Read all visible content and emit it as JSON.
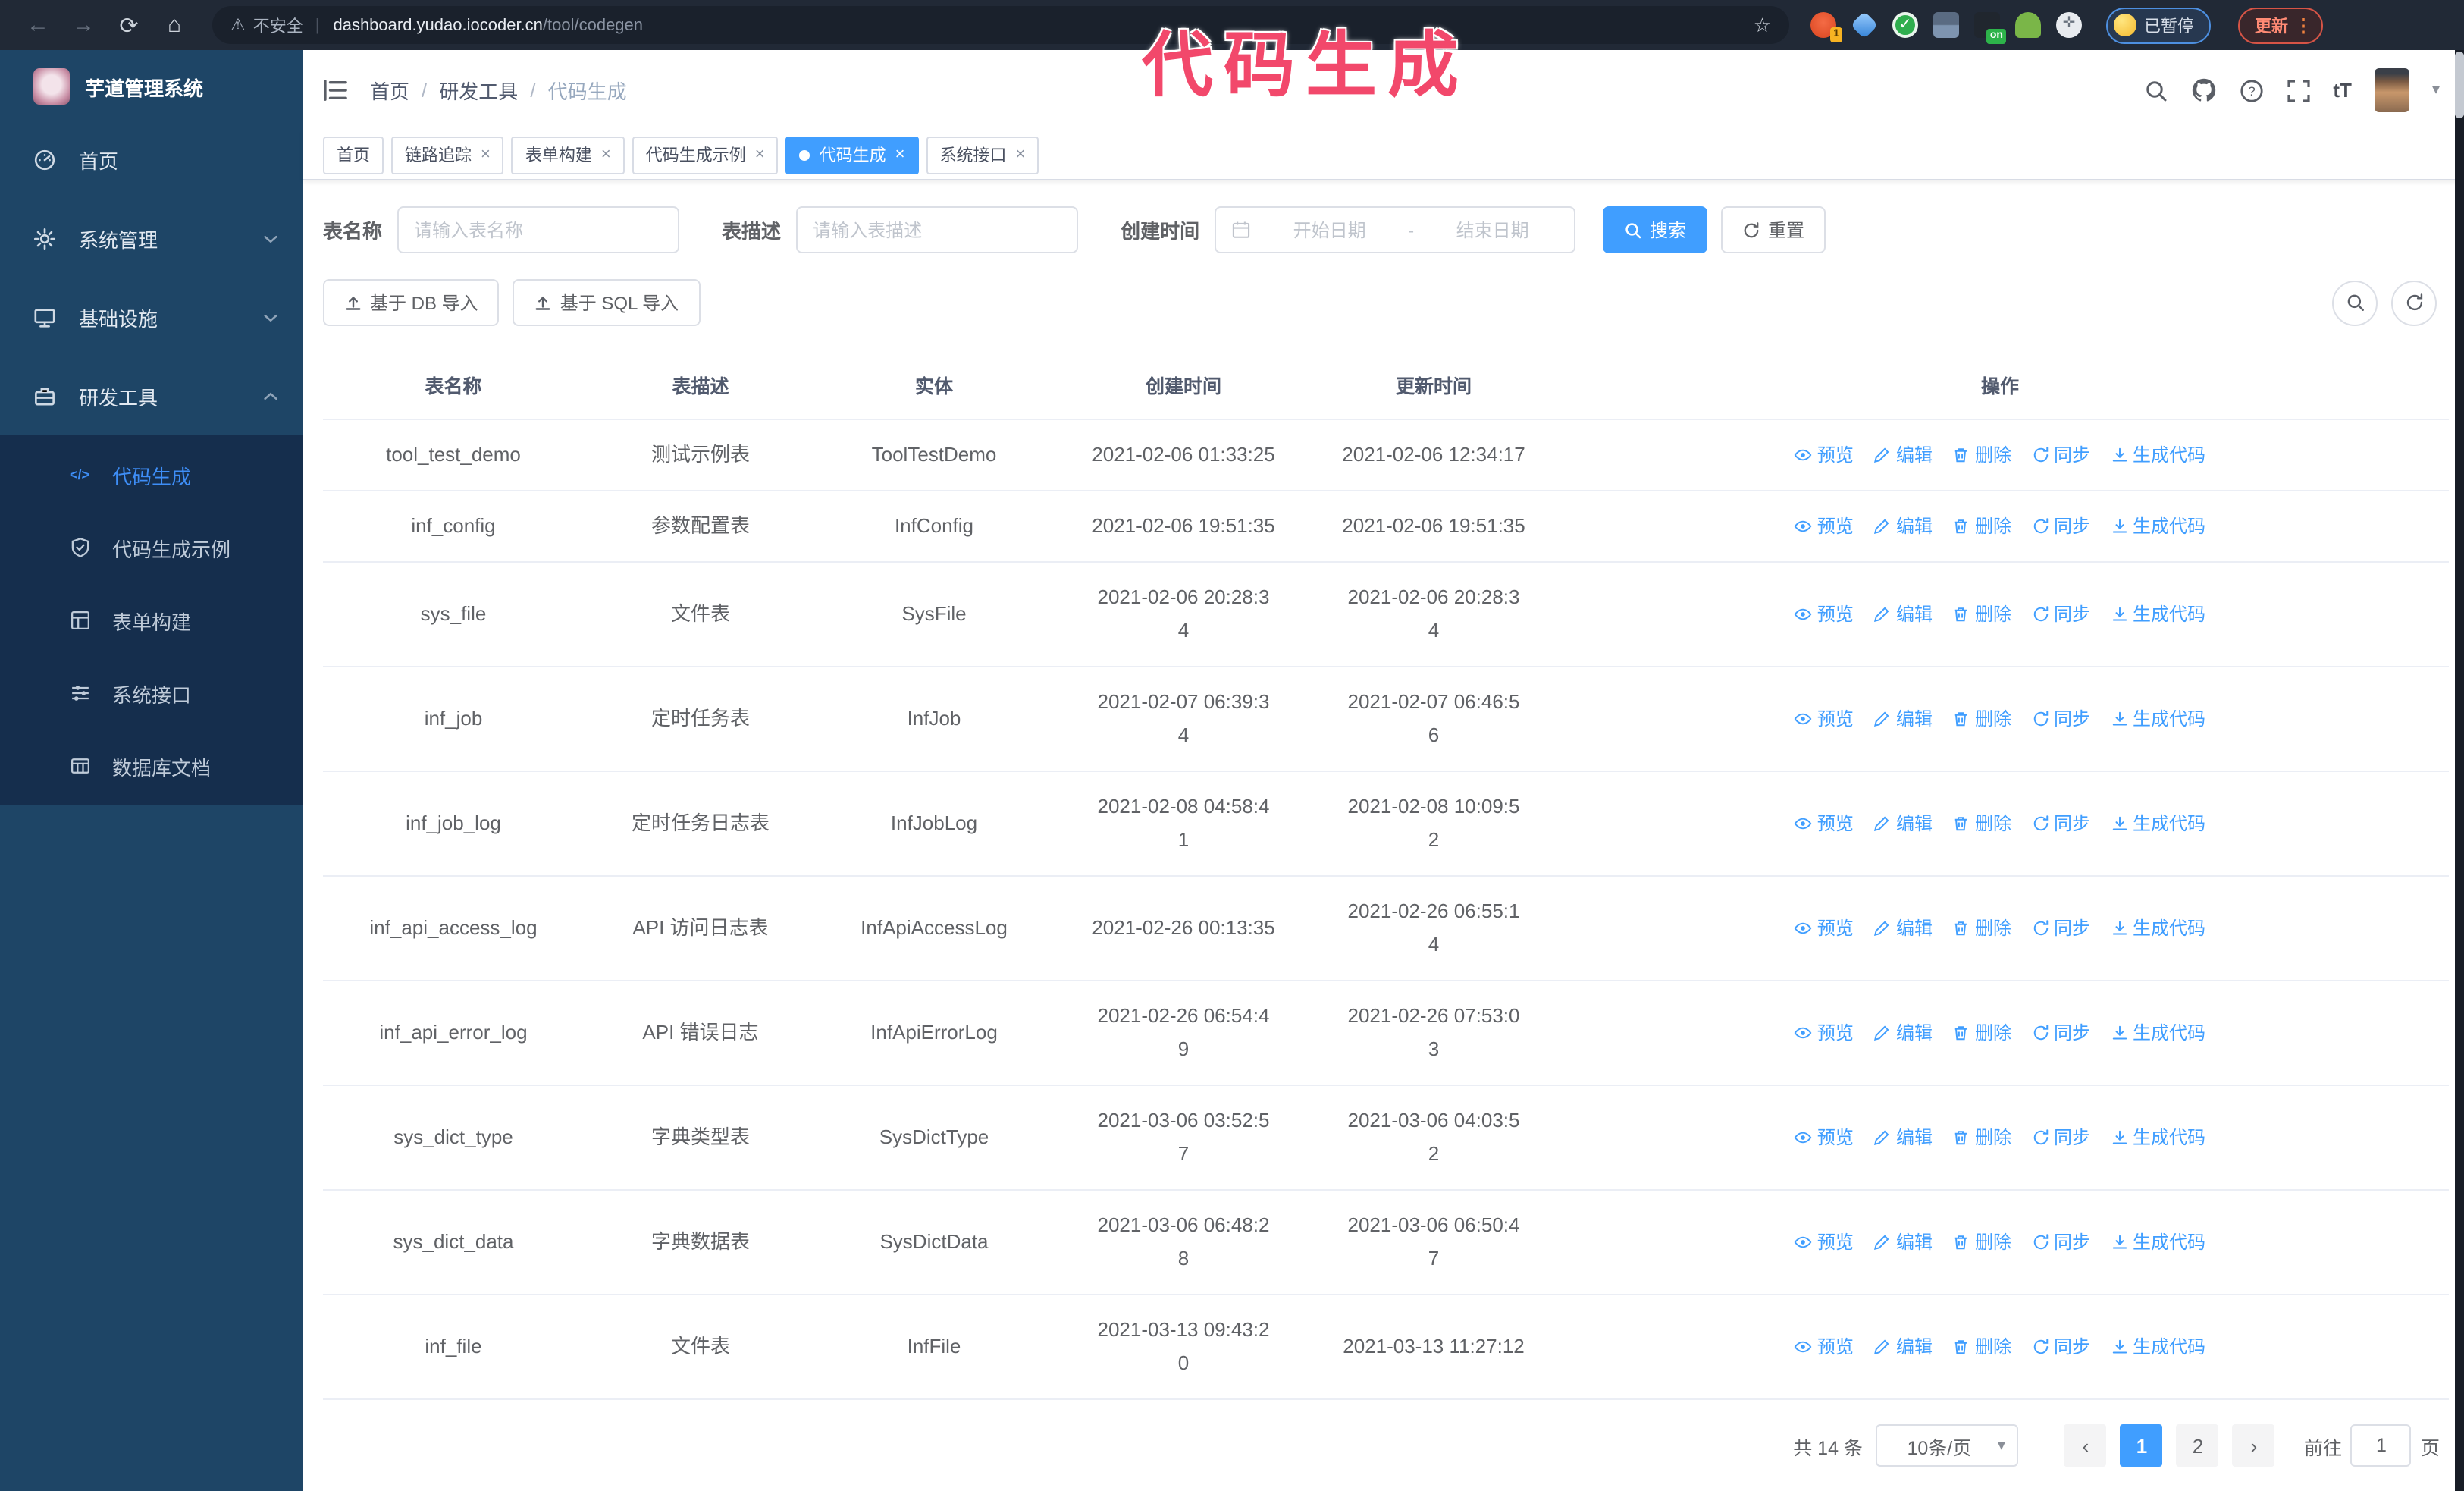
{
  "browser": {
    "security_label": "不安全",
    "url_host": "dashboard.yudao.iocoder.cn",
    "url_path": "/tool/codegen",
    "ext_badge_1": "1",
    "ext_badge_on": "on",
    "paused_label": "已暂停",
    "update_label": "更新"
  },
  "glyphs": {
    "back": "←",
    "forward": "→",
    "reload": "⟳",
    "home": "⌂",
    "warning": "⚠",
    "star": "☆",
    "divider": "|",
    "caret_down": "▾",
    "menu_dots": "⋮",
    "close": "×",
    "question": "?",
    "font_size": "tT",
    "prev": "‹",
    "next": "›",
    "check": "✓",
    "puzzle": "✛",
    "code": "</>",
    "dash": "-"
  },
  "annotation": {
    "text": "代码生成"
  },
  "sidebar": {
    "logo_title": "芋道管理系统",
    "items": [
      {
        "label": "首页"
      },
      {
        "label": "系统管理"
      },
      {
        "label": "基础设施"
      },
      {
        "label": "研发工具"
      }
    ],
    "submenu": [
      {
        "label": "代码生成",
        "active": true
      },
      {
        "label": "代码生成示例"
      },
      {
        "label": "表单构建"
      },
      {
        "label": "系统接口"
      },
      {
        "label": "数据库文档"
      }
    ]
  },
  "header": {
    "breadcrumb": [
      "首页",
      "研发工具",
      "代码生成"
    ]
  },
  "tabs": [
    {
      "label": "首页"
    },
    {
      "label": "链路追踪"
    },
    {
      "label": "表单构建"
    },
    {
      "label": "代码生成示例"
    },
    {
      "label": "代码生成"
    },
    {
      "label": "系统接口"
    }
  ],
  "filters": {
    "table_name_label": "表名称",
    "table_name_placeholder": "请输入表名称",
    "table_desc_label": "表描述",
    "table_desc_placeholder": "请输入表描述",
    "create_time_label": "创建时间",
    "date_start_placeholder": "开始日期",
    "date_end_placeholder": "结束日期",
    "search_label": "搜索",
    "reset_label": "重置"
  },
  "toolbar": {
    "import_db_label": "基于 DB 导入",
    "import_sql_label": "基于 SQL 导入"
  },
  "table": {
    "columns": [
      "表名称",
      "表描述",
      "实体",
      "创建时间",
      "更新时间",
      "操作"
    ],
    "actions": [
      "预览",
      "编辑",
      "删除",
      "同步",
      "生成代码"
    ],
    "rows": [
      {
        "name": "tool_test_demo",
        "desc": "测试示例表",
        "entity": "ToolTestDemo",
        "created": "2021-02-06 01:33:25",
        "updated": "2021-02-06 12:34:17"
      },
      {
        "name": "inf_config",
        "desc": "参数配置表",
        "entity": "InfConfig",
        "created": "2021-02-06 19:51:35",
        "updated": "2021-02-06 19:51:35"
      },
      {
        "name": "sys_file",
        "desc": "文件表",
        "entity": "SysFile",
        "created": "2021-02-06 20:28:3\n4",
        "updated": "2021-02-06 20:28:3\n4"
      },
      {
        "name": "inf_job",
        "desc": "定时任务表",
        "entity": "InfJob",
        "created": "2021-02-07 06:39:3\n4",
        "updated": "2021-02-07 06:46:5\n6"
      },
      {
        "name": "inf_job_log",
        "desc": "定时任务日志表",
        "entity": "InfJobLog",
        "created": "2021-02-08 04:58:4\n1",
        "updated": "2021-02-08 10:09:5\n2"
      },
      {
        "name": "inf_api_access_log",
        "desc": "API 访问日志表",
        "entity": "InfApiAccessLog",
        "created": "2021-02-26 00:13:35",
        "updated": "2021-02-26 06:55:1\n4"
      },
      {
        "name": "inf_api_error_log",
        "desc": "API 错误日志",
        "entity": "InfApiErrorLog",
        "created": "2021-02-26 06:54:4\n9",
        "updated": "2021-02-26 07:53:0\n3"
      },
      {
        "name": "sys_dict_type",
        "desc": "字典类型表",
        "entity": "SysDictType",
        "created": "2021-03-06 03:52:5\n7",
        "updated": "2021-03-06 04:03:5\n2"
      },
      {
        "name": "sys_dict_data",
        "desc": "字典数据表",
        "entity": "SysDictData",
        "created": "2021-03-06 06:48:2\n8",
        "updated": "2021-03-06 06:50:4\n7"
      },
      {
        "name": "inf_file",
        "desc": "文件表",
        "entity": "InfFile",
        "created": "2021-03-13 09:43:2\n0",
        "updated": "2021-03-13 11:27:12"
      }
    ]
  },
  "pagination": {
    "total_label": "共 14 条",
    "page_size_label": "10条/页",
    "pages": [
      "1",
      "2"
    ],
    "current": "1",
    "jump_prefix": "前往",
    "jump_value": "1",
    "jump_suffix": "页"
  },
  "colors": {
    "accent": "#409eff",
    "annotation": "#f2486b",
    "sidebar_bg": "#1e4566",
    "submenu_bg": "#152e4d",
    "active_tab_bg": "#409eff"
  }
}
